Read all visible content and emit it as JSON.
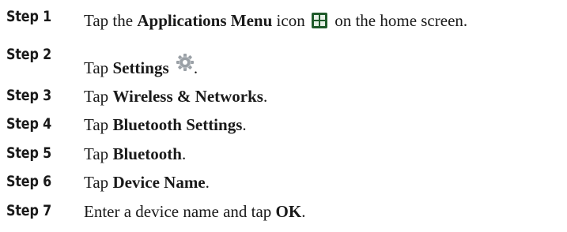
{
  "steps": [
    {
      "label": "Step 1",
      "parts": {
        "pre": "Tap the ",
        "bold": "Applications Menu",
        "post": " icon",
        "post2": " on the home screen."
      },
      "icon": "applications-menu-icon"
    },
    {
      "label": "Step 2",
      "parts": {
        "pre": "Tap ",
        "bold": "Settings",
        "post": ".",
        "post2": ""
      },
      "icon": "settings-gear-icon"
    },
    {
      "label": "Step 3",
      "parts": {
        "pre": "Tap ",
        "bold": "Wireless & Networks",
        "post": ".",
        "post2": ""
      }
    },
    {
      "label": "Step 4",
      "parts": {
        "pre": "Tap ",
        "bold": "Bluetooth Settings",
        "post": ".",
        "post2": ""
      }
    },
    {
      "label": "Step 5",
      "parts": {
        "pre": "Tap ",
        "bold": "Bluetooth",
        "post": ".",
        "post2": ""
      }
    },
    {
      "label": "Step 6",
      "parts": {
        "pre": "Tap ",
        "bold": "Device Name",
        "post": ".",
        "post2": ""
      }
    },
    {
      "label": "Step 7",
      "parts": {
        "pre": "Enter a device name and tap ",
        "bold": "OK",
        "post": ".",
        "post2": ""
      }
    }
  ],
  "colors": {
    "text": "#1a1a1a",
    "apps_icon_bg": "#1f5a2a",
    "apps_icon_tiles": "#e6f0e6",
    "settings_icon": "#9aa0a6"
  }
}
